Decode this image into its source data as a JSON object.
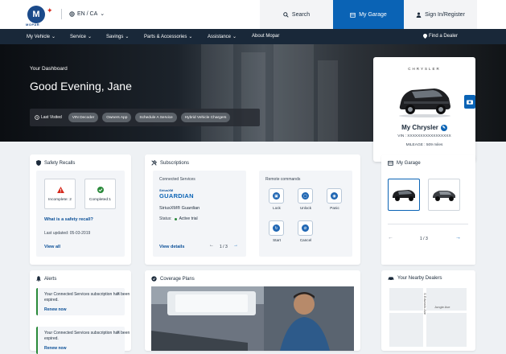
{
  "brand": {
    "logo": "M",
    "logo_sub": "MOPAR"
  },
  "header": {
    "language": "EN / CA",
    "search": "Search",
    "garage": "My Garage",
    "sign_in": "Sign In/Register"
  },
  "nav": {
    "items": [
      "My Vehicle",
      "Service",
      "Savings",
      "Parts & Accessories",
      "Assistance"
    ],
    "about": "About Mopar",
    "find_dealer": "Find a Dealer"
  },
  "hero": {
    "dashboard_label": "Your Dashboard",
    "greeting": "Good Evening, Jane",
    "last_visited": "Last Visited",
    "quick_links": [
      "VIN Decoder",
      "Owners App",
      "Schedule A Service",
      "Hybrid Vehicle Chargers"
    ]
  },
  "vehicle": {
    "brand": "CHRYSLER",
    "name": "My Chrysler",
    "vin": "VIN : XXXXXXXXXXXXXXXXX",
    "mileage": "MILEAGE : 509 miles"
  },
  "recalls": {
    "title": "Safety Recalls",
    "incomplete": "Incomplete: 2",
    "completed": "Completed:1",
    "what_link": "What is a safety recall?",
    "last_updated": "Last updated: 05-03-2019",
    "view_all": "View all"
  },
  "subscriptions": {
    "title": "Subscriptions",
    "connected_label": "Connected Services",
    "provider_line1": "SiriusXM",
    "provider_line2": "GUARDIAN",
    "provider_name": "SiriusXM® Guardian",
    "status_label": "Status:",
    "status_value": "Active trial",
    "view_details": "View details",
    "pager": "1 / 3",
    "remote_label": "Remote commands",
    "commands": [
      "Lock",
      "Unlock",
      "Panic",
      "Start",
      "Cancel"
    ]
  },
  "garage": {
    "title": "My Garage",
    "pager": "1 / 3"
  },
  "alerts": {
    "title": "Alerts",
    "items": [
      {
        "text": "Your Connected Services subscription has been expired.",
        "action": "Renew now"
      },
      {
        "text": "Your Connected Services subscription has been expired.",
        "action": "Renew now"
      }
    ]
  },
  "coverage": {
    "title": "Coverage Plans"
  },
  "dealers": {
    "title": "Your Nearby Dealers",
    "street1": "S Edwards Ave",
    "street2": "Jungle Ave"
  },
  "colors": {
    "accent": "#0a63b5",
    "nav_bg": "#192839",
    "alert_green": "#2a8a3a",
    "recall_red": "#d52b1e",
    "complete_green": "#2a8a3a"
  }
}
